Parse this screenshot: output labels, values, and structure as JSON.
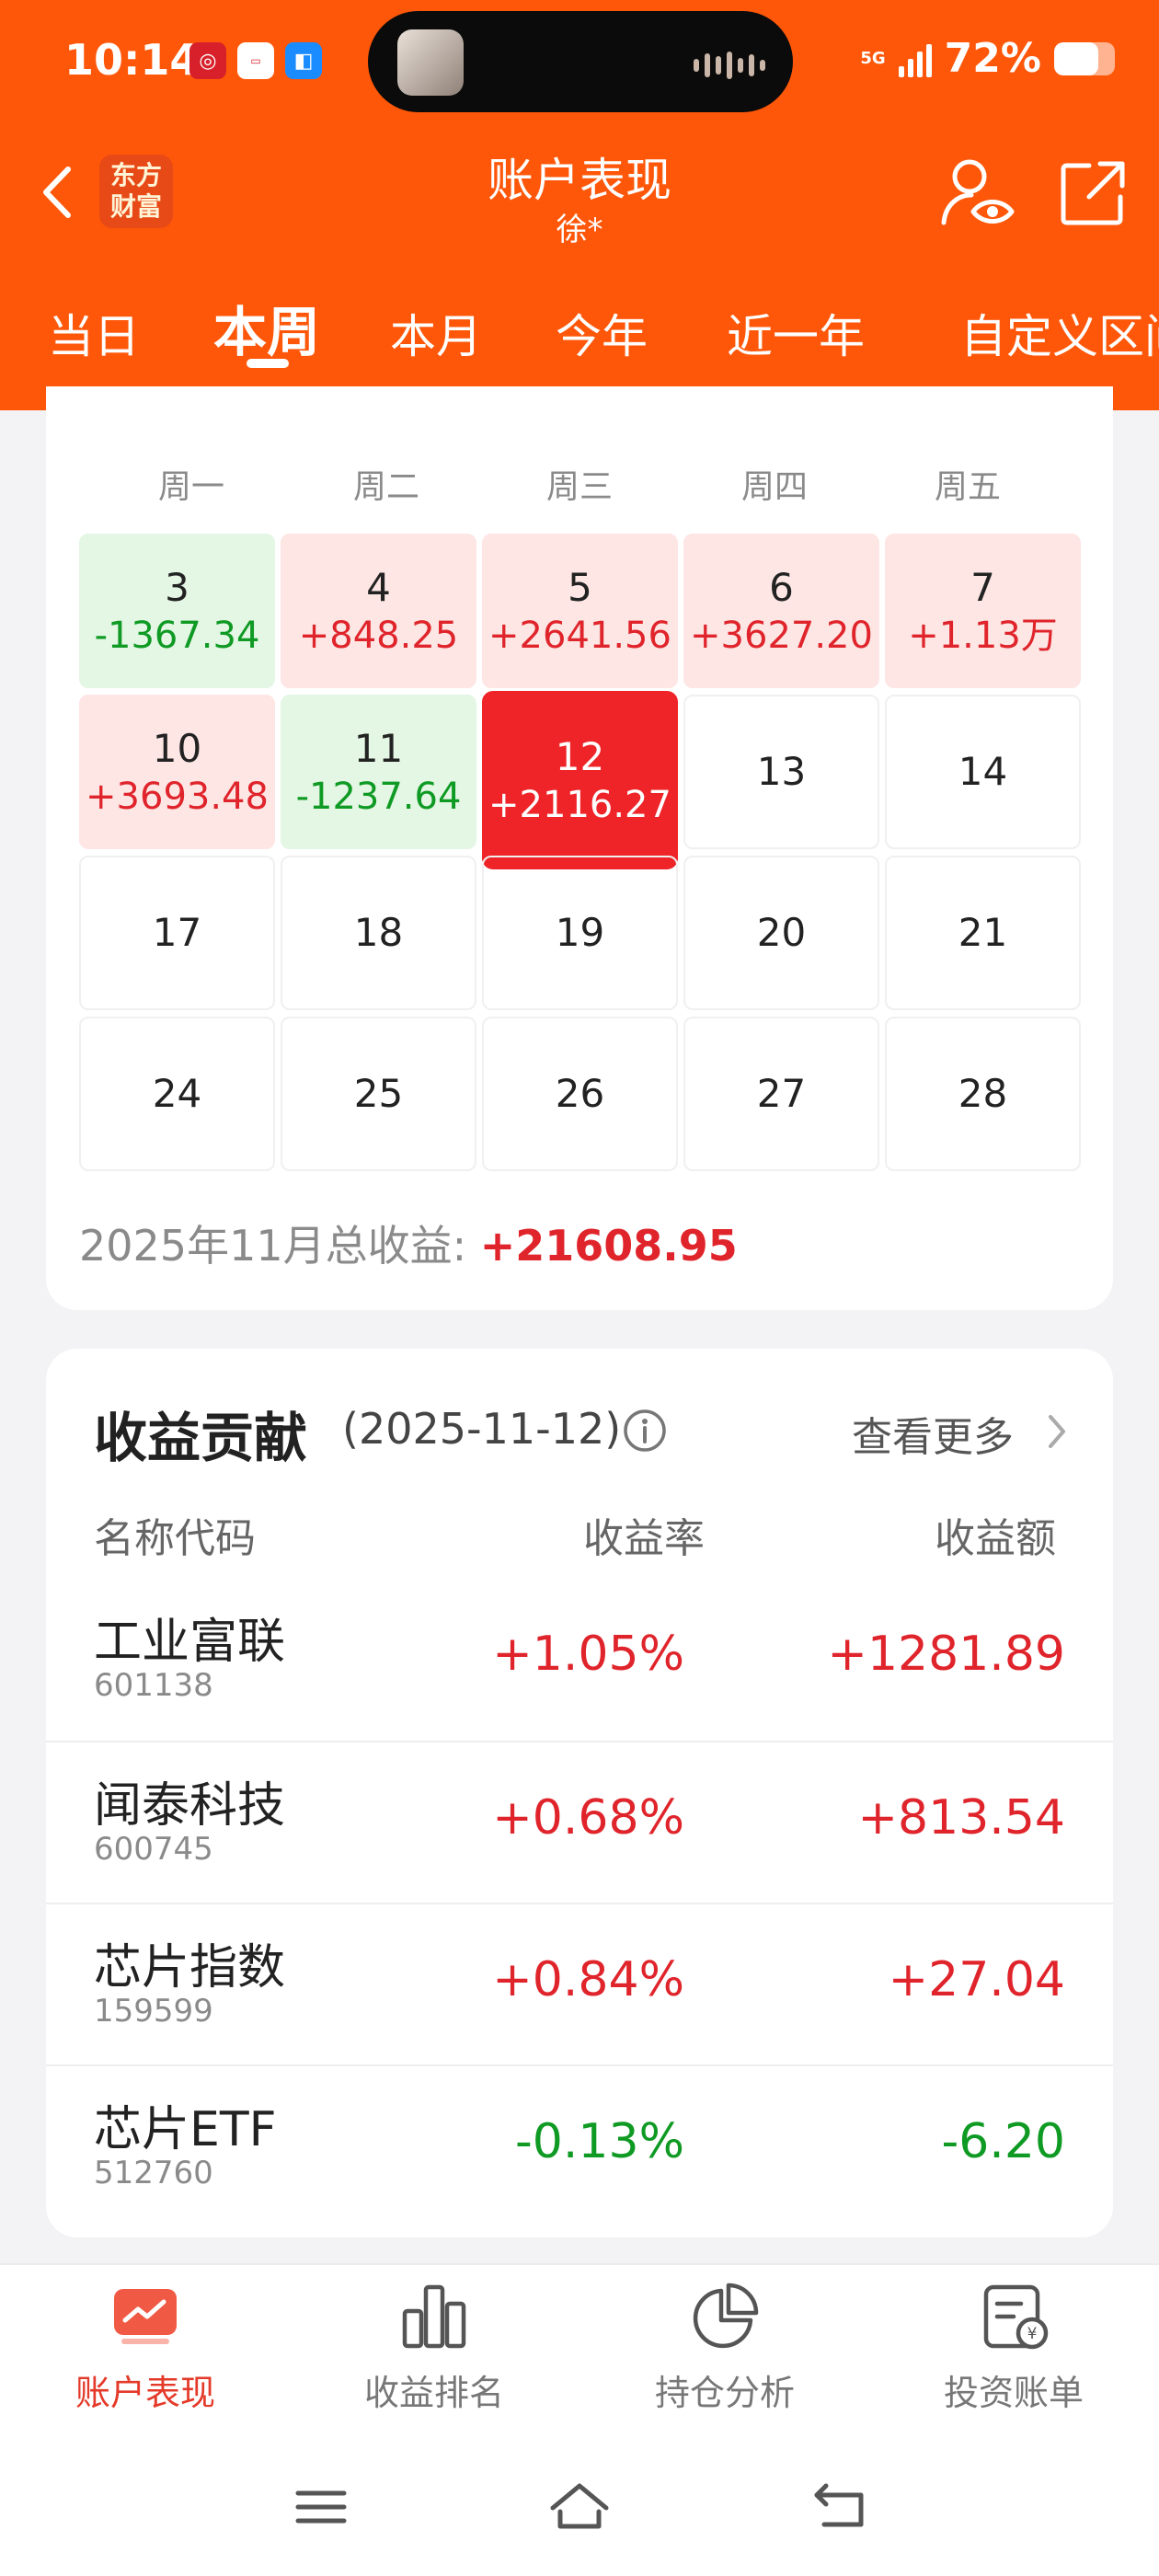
{
  "status_bar": {
    "time": "10:14",
    "network": "5G",
    "battery_percent": "72%",
    "battery_level": 0.72
  },
  "header": {
    "logo_line1": "东方",
    "logo_line2": "财富",
    "title": "账户表现",
    "subtitle": "徐*"
  },
  "tabs": [
    {
      "label": "当日",
      "active": false
    },
    {
      "label": "本周",
      "active": true
    },
    {
      "label": "本月",
      "active": false
    },
    {
      "label": "今年",
      "active": false
    },
    {
      "label": "近一年",
      "active": false
    },
    {
      "label": "自定义区间",
      "active": false
    }
  ],
  "calendar": {
    "weekdays": [
      "周一",
      "周二",
      "周三",
      "周四",
      "周五"
    ],
    "rows": [
      [
        {
          "day": "3",
          "value": "-1367.34",
          "state": "down"
        },
        {
          "day": "4",
          "value": "+848.25",
          "state": "up"
        },
        {
          "day": "5",
          "value": "+2641.56",
          "state": "up"
        },
        {
          "day": "6",
          "value": "+3627.20",
          "state": "up"
        },
        {
          "day": "7",
          "value": "+1.13万",
          "state": "up"
        }
      ],
      [
        {
          "day": "10",
          "value": "+3693.48",
          "state": "up"
        },
        {
          "day": "11",
          "value": "-1237.64",
          "state": "down"
        },
        {
          "day": "12",
          "value": "+2116.27",
          "state": "today"
        },
        {
          "day": "13",
          "value": "",
          "state": "none"
        },
        {
          "day": "14",
          "value": "",
          "state": "none"
        }
      ],
      [
        {
          "day": "17",
          "value": "",
          "state": "none"
        },
        {
          "day": "18",
          "value": "",
          "state": "none"
        },
        {
          "day": "19",
          "value": "",
          "state": "none"
        },
        {
          "day": "20",
          "value": "",
          "state": "none"
        },
        {
          "day": "21",
          "value": "",
          "state": "none"
        }
      ],
      [
        {
          "day": "24",
          "value": "",
          "state": "none"
        },
        {
          "day": "25",
          "value": "",
          "state": "none"
        },
        {
          "day": "26",
          "value": "",
          "state": "none"
        },
        {
          "day": "27",
          "value": "",
          "state": "none"
        },
        {
          "day": "28",
          "value": "",
          "state": "none"
        }
      ]
    ],
    "total_label": "2025年11月总收益: ",
    "total_value": "+21608.95"
  },
  "contribution": {
    "title": "收益贡献",
    "date": "(2025-11-12)",
    "more": "查看更多",
    "headers": {
      "name": "名称代码",
      "rate": "收益率",
      "amount": "收益额"
    },
    "rows": [
      {
        "name": "工业富联",
        "code": "601138",
        "rate": "+1.05%",
        "amount": "+1281.89",
        "dir": "pos"
      },
      {
        "name": "闻泰科技",
        "code": "600745",
        "rate": "+0.68%",
        "amount": "+813.54",
        "dir": "pos"
      },
      {
        "name": "芯片指数",
        "code": "159599",
        "rate": "+0.84%",
        "amount": "+27.04",
        "dir": "pos"
      },
      {
        "name": "芯片ETF",
        "code": "512760",
        "rate": "-0.13%",
        "amount": "-6.20",
        "dir": "neg"
      }
    ]
  },
  "bottom_nav": [
    {
      "label": "账户表现",
      "icon": "account-performance-icon",
      "active": true
    },
    {
      "label": "收益排名",
      "icon": "bar-chart-icon",
      "active": false
    },
    {
      "label": "持仓分析",
      "icon": "pie-chart-icon",
      "active": false
    },
    {
      "label": "投资账单",
      "icon": "bill-icon",
      "active": false
    }
  ],
  "colors": {
    "brand_orange": "#fe5709",
    "gain_red": "#e0242b",
    "loss_green": "#0f9a24",
    "today_red": "#ee2428"
  }
}
